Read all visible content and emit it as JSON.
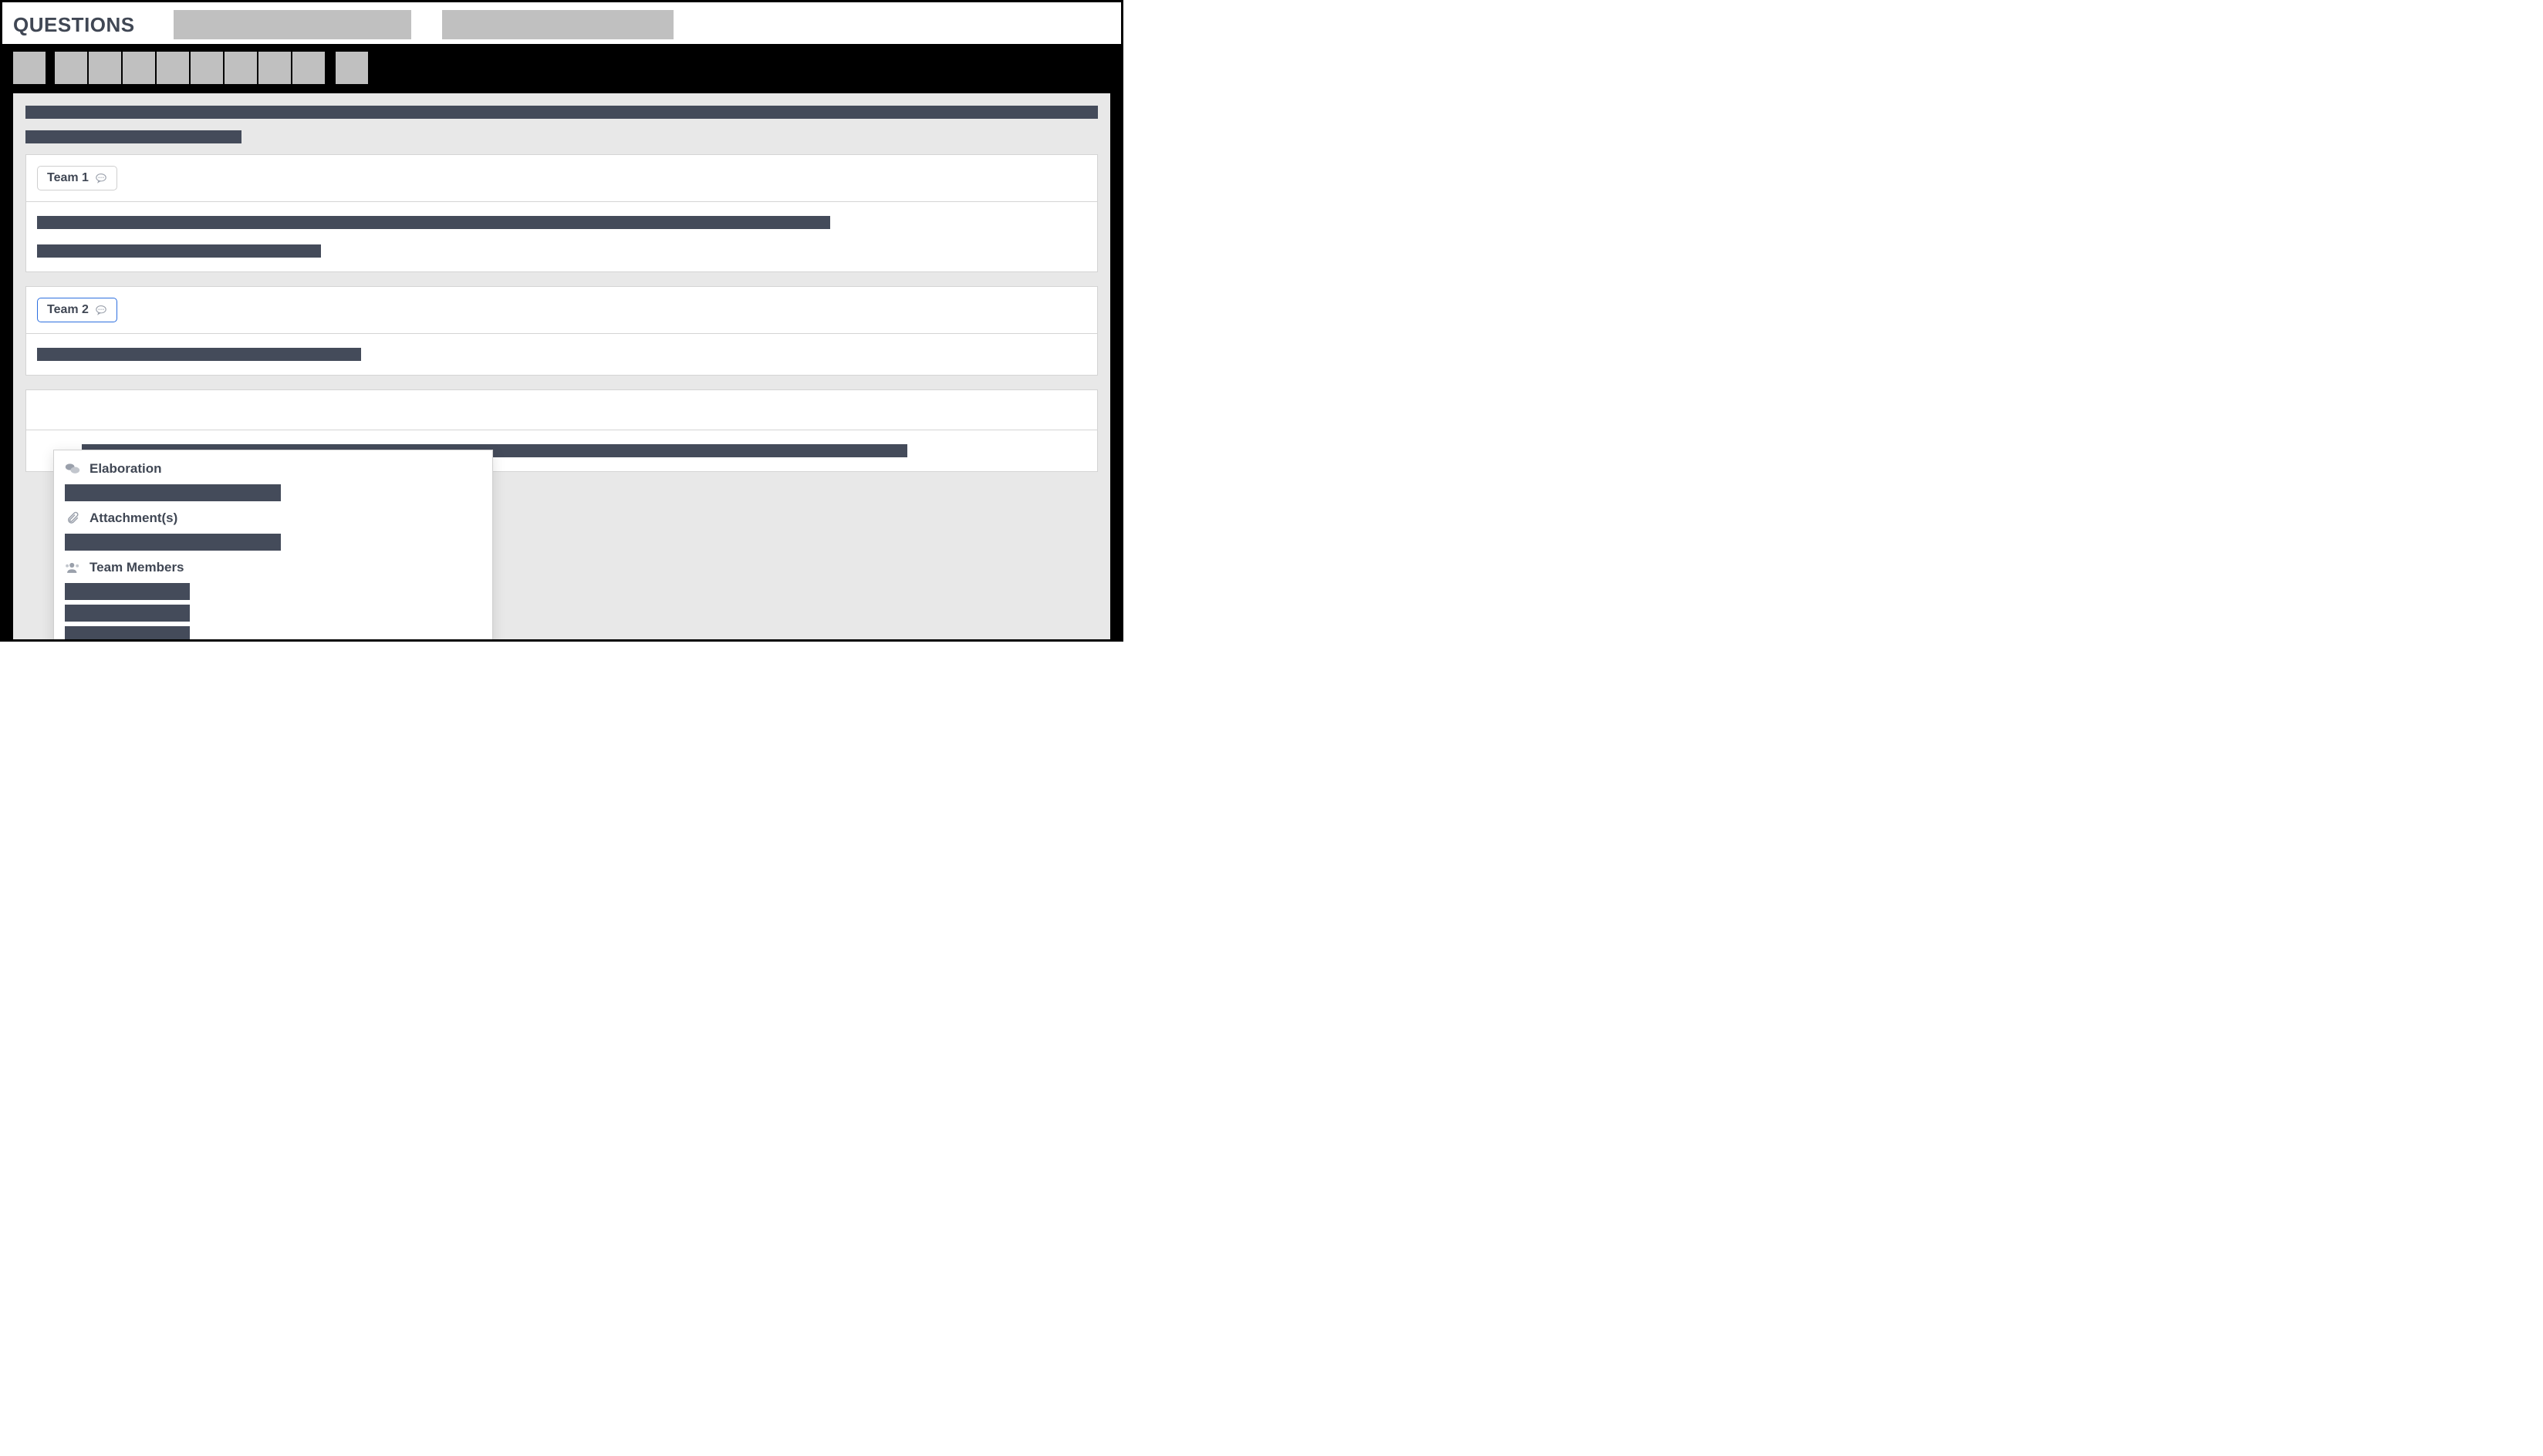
{
  "header": {
    "title": "QUESTIONS"
  },
  "teams": {
    "team1": {
      "label": "Team 1"
    },
    "team2": {
      "label": "Team 2"
    }
  },
  "popover": {
    "elaboration_label": "Elaboration",
    "attachments_label": "Attachment(s)",
    "members_label": "Team Members"
  }
}
